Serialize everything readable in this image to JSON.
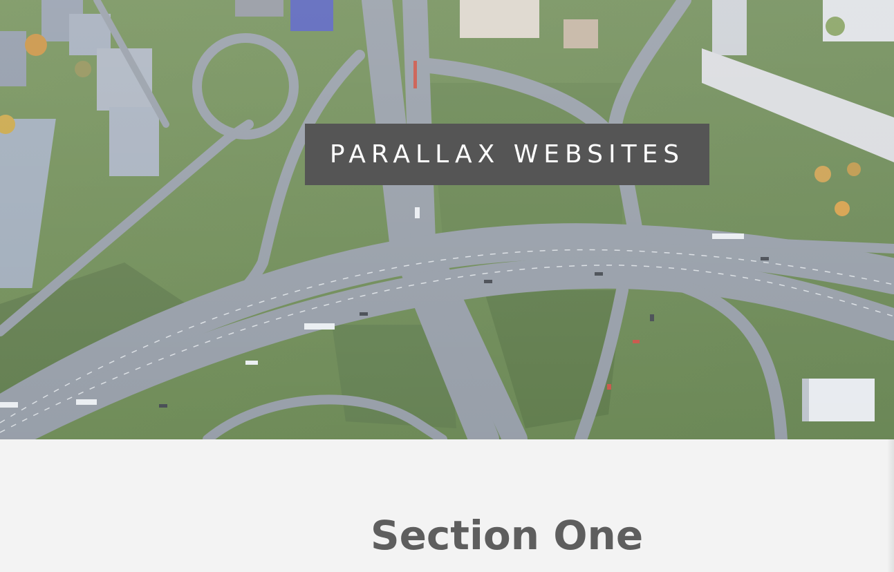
{
  "hero": {
    "title": "PARALLAX WEBSITES",
    "image_icon": "aerial-highway-interchange-image",
    "colors": {
      "banner": "#555555",
      "title_text": "#ffffff"
    }
  },
  "section": {
    "title": "Section One",
    "colors": {
      "background": "#f3f3f3",
      "title_text": "#5e5e5e"
    }
  }
}
